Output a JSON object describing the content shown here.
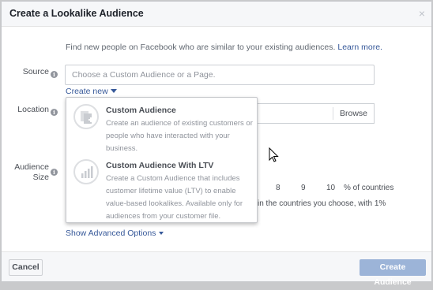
{
  "dialog": {
    "title": "Create a Lookalike Audience",
    "close_glyph": "×"
  },
  "intro": {
    "text": "Find new people on Facebook who are similar to your existing audiences. ",
    "link": "Learn more."
  },
  "source": {
    "label": "Source",
    "placeholder": "Choose a Custom Audience or a Page.",
    "create_new": "Create new"
  },
  "location": {
    "label": "Location",
    "browse": "Browse"
  },
  "audience_size": {
    "label": "Audience Size",
    "scale": [
      "8",
      "9",
      "10"
    ],
    "unit": "% of countries",
    "description": "in the countries you choose, with 1%"
  },
  "menu": {
    "items": [
      {
        "title": "Custom Audience",
        "description": "Create an audience of existing customers or people who have interacted with your business.",
        "icon": "custom-audience-icon"
      },
      {
        "title": "Custom Audience With LTV",
        "description": "Create a Custom Audience that includes customer lifetime value (LTV) to enable value-based lookalikes. Available only for audiences from your customer file.",
        "icon": "ltv-bar-chart-icon"
      }
    ]
  },
  "advanced": {
    "label": "Show Advanced Options"
  },
  "footer": {
    "cancel": "Cancel",
    "create": "Create Audience"
  },
  "colors": {
    "link": "#365899",
    "primary_disabled": "#9cb4d8",
    "header_bg": "#f6f7f9"
  }
}
